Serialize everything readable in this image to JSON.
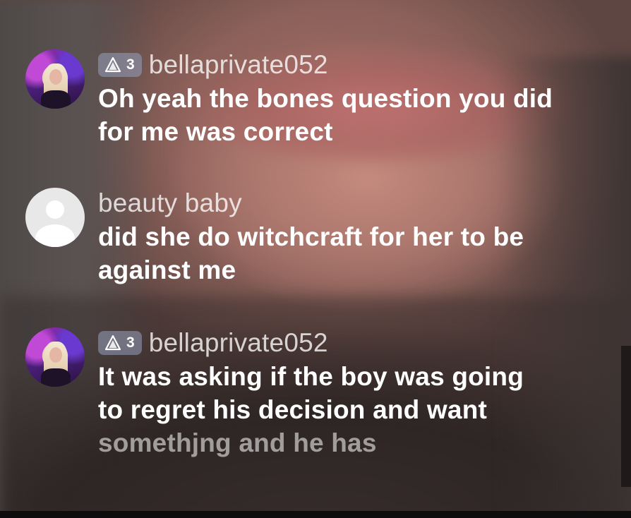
{
  "app": {
    "background_colors": {
      "skin": "#b07a70",
      "shirt": "#2e2625",
      "badge_bg": "#8f99b8"
    }
  },
  "comments": [
    {
      "avatar": "user-photo-avatar",
      "badge": {
        "icon": "triangle-level-icon",
        "level": "3"
      },
      "username": "bellaprivate052",
      "message_lines": [
        "Oh yeah the bones question you did",
        "for me was correct"
      ]
    },
    {
      "avatar": "default-user-avatar",
      "badge": null,
      "username": "beauty baby",
      "message_lines": [
        "did she do witchcraft for her to be",
        "against me"
      ]
    },
    {
      "avatar": "user-photo-avatar",
      "badge": {
        "icon": "triangle-level-icon",
        "level": "3"
      },
      "username": "bellaprivate052",
      "message_lines": [
        "It was asking if the boy was going",
        "to regret his decision and want",
        "somethjng and he has"
      ]
    }
  ]
}
